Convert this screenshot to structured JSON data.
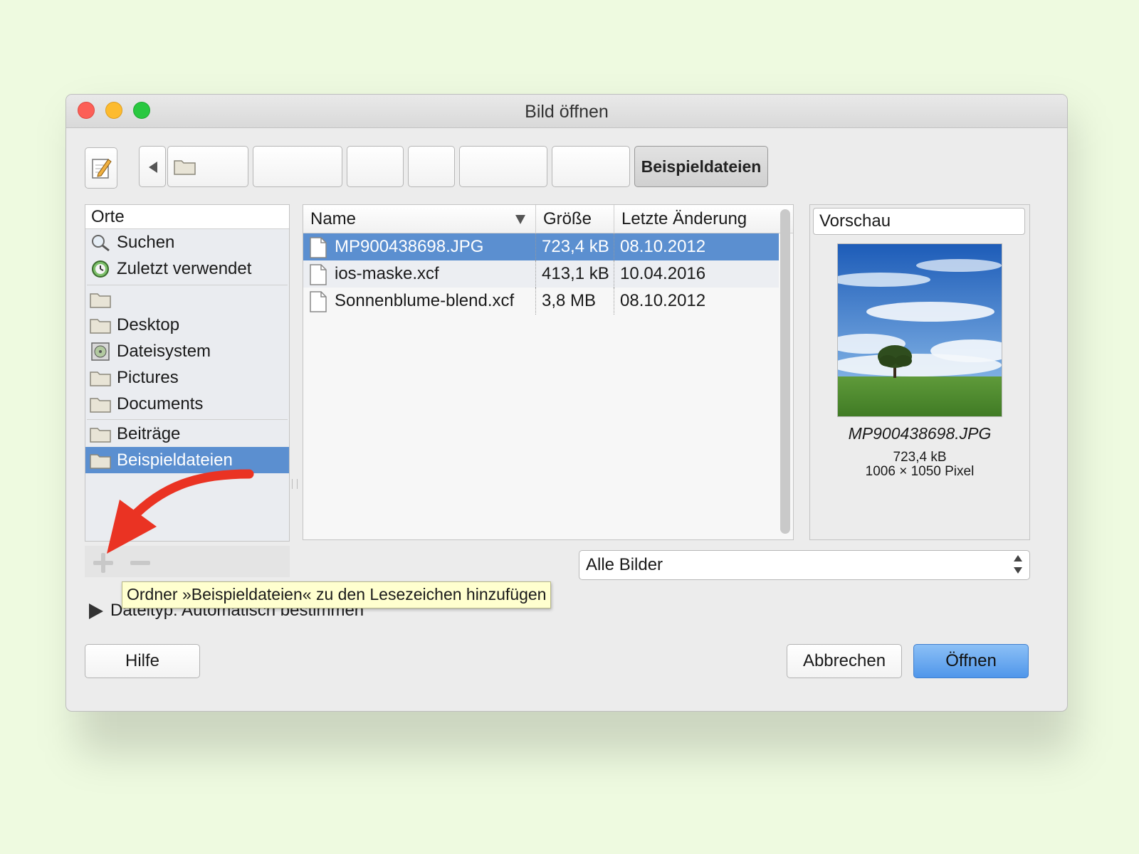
{
  "window": {
    "title": "Bild öffnen"
  },
  "pathbar": {
    "edit_icon": "pencil-notepad-icon",
    "back_icon": "triangle-left-icon",
    "crumbs": [
      {
        "label": ""
      },
      {
        "label": ""
      },
      {
        "label": ""
      },
      {
        "label": ""
      },
      {
        "label": ""
      },
      {
        "label": ""
      },
      {
        "label": "Beispieldateien"
      }
    ]
  },
  "places": {
    "header": "Orte",
    "items": [
      {
        "label": "Suchen",
        "icon": "magnifier-icon"
      },
      {
        "label": "Zuletzt verwendet",
        "icon": "recent-clock-icon"
      },
      {
        "label": "",
        "icon": "folder-icon"
      },
      {
        "label": "Desktop",
        "icon": "folder-icon"
      },
      {
        "label": "Dateisystem",
        "icon": "filesystem-icon"
      },
      {
        "label": "Pictures",
        "icon": "folder-icon"
      },
      {
        "label": "Documents",
        "icon": "folder-icon"
      },
      {
        "label": "Beiträge",
        "icon": "folder-icon"
      },
      {
        "label": "Beispieldateien",
        "icon": "folder-icon",
        "selected": true
      }
    ]
  },
  "files": {
    "columns": [
      "Name",
      "Größe",
      "Letzte Änderung"
    ],
    "rows": [
      {
        "name": "MP900438698.JPG",
        "size": "723,4 kB",
        "modified": "08.10.2012",
        "selected": true
      },
      {
        "name": "ios-maske.xcf",
        "size": "413,1 kB",
        "modified": "10.04.2016"
      },
      {
        "name": "Sonnenblume-blend.xcf",
        "size": "3,8 MB",
        "modified": "08.10.2012"
      }
    ]
  },
  "preview": {
    "header": "Vorschau",
    "name": "MP900438698.JPG",
    "size": "723,4 kB",
    "dimensions": "1006 × 1050 Pixel"
  },
  "filter": {
    "value": "Alle Bilder"
  },
  "filetype": {
    "label": "Dateityp: Automatisch bestimmen"
  },
  "tooltip": {
    "text": "Ordner »Beispieldateien« zu den Lesezeichen hinzufügen"
  },
  "buttons": {
    "help": "Hilfe",
    "cancel": "Abbrechen",
    "open": "Öffnen"
  },
  "colors": {
    "selection": "#5b8fd0",
    "open_button": "#5b9eee",
    "annotation_arrow": "#ea3323"
  }
}
